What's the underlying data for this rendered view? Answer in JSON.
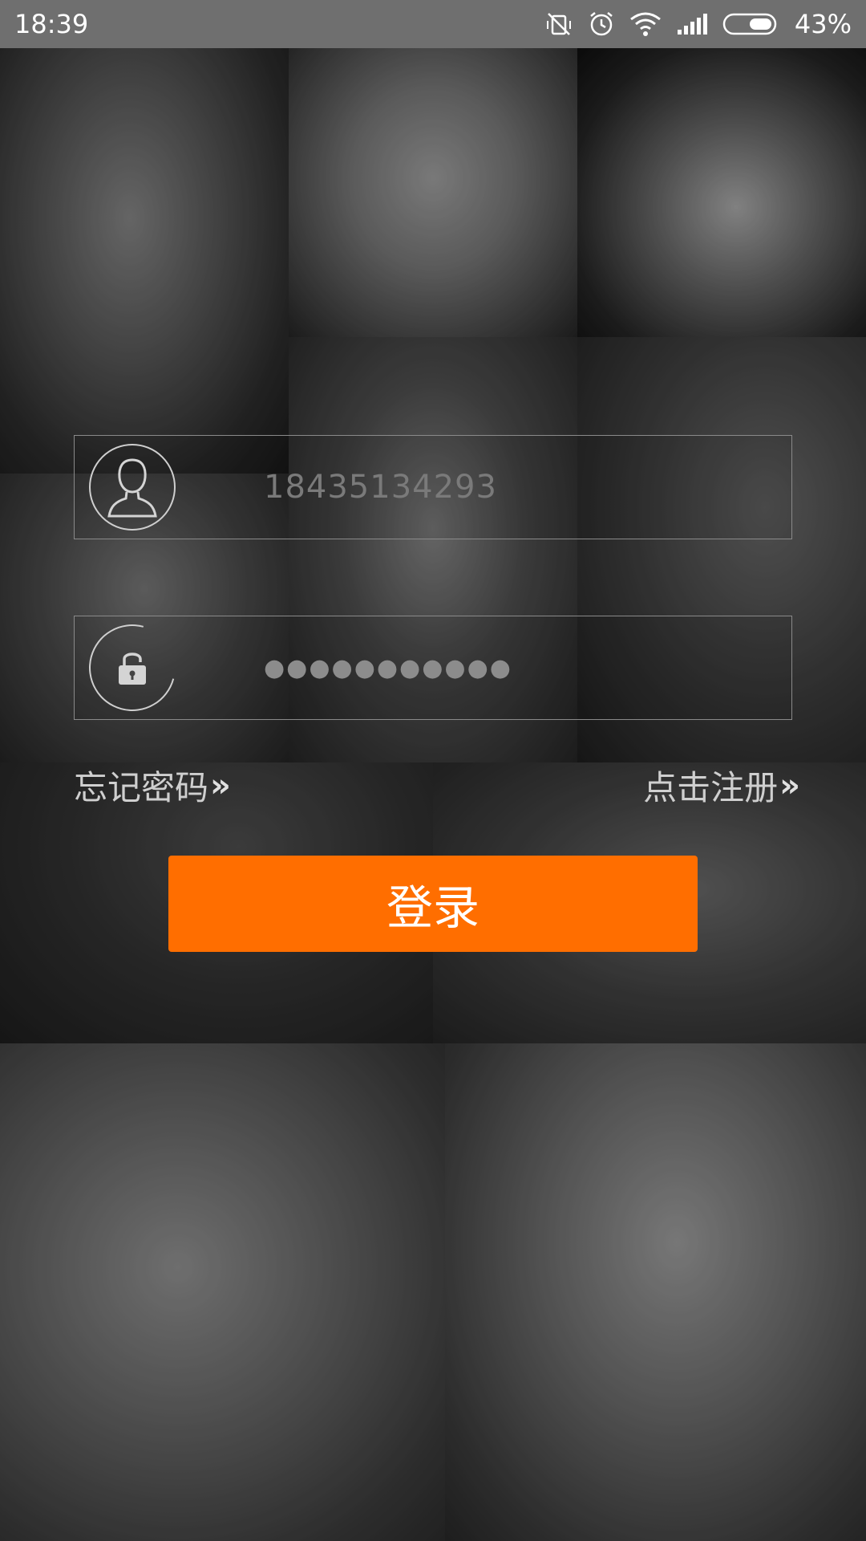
{
  "status_bar": {
    "time": "18:39",
    "battery_percent": "43%",
    "icons": [
      "vibrate-off-icon",
      "alarm-icon",
      "wifi-icon",
      "signal-icon",
      "battery-icon"
    ]
  },
  "login_form": {
    "username_value": "18435134293",
    "password_masked": "●●●●●●●●●●●",
    "user_icon": "user-avatar-icon",
    "lock_icon": "lock-icon"
  },
  "links": {
    "forgot_password": "忘记密码",
    "register": "点击注册",
    "chevron": "»"
  },
  "login_button": {
    "label": "登录"
  },
  "colors": {
    "accent": "#ff6e00",
    "status_bar": "#6f6f6f"
  }
}
